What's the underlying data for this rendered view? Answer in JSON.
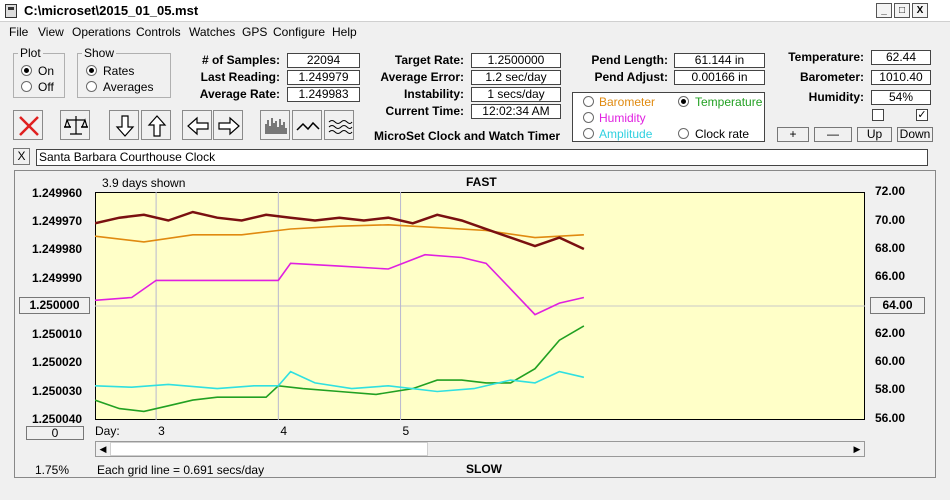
{
  "window": {
    "title": "C:\\microset\\2015_01_05.mst",
    "min": "_",
    "max": "□",
    "close": "X"
  },
  "menu": [
    "File",
    "View",
    "Operations",
    "Controls",
    "Watches",
    "GPS",
    "Configure",
    "Help"
  ],
  "plot": {
    "legend": "Plot",
    "on": "On",
    "off": "Off",
    "selected": "On"
  },
  "show": {
    "legend": "Show",
    "rates": "Rates",
    "averages": "Averages",
    "selected": "Rates"
  },
  "stats": {
    "samples_label": "# of Samples:",
    "samples": "22094",
    "last_label": "Last Reading:",
    "last": "1.249979",
    "avg_rate_label": "Average Rate:",
    "avg_rate": "1.249983"
  },
  "target": {
    "rate_label": "Target Rate:",
    "rate": "1.2500000",
    "avg_err_label": "Average Error:",
    "avg_err": "1.2 sec/day",
    "instab_label": "Instability:",
    "instab": "1 secs/day",
    "time_label": "Current Time:",
    "time": "12:02:34 AM"
  },
  "app_name": "MicroSet Clock and Watch Timer",
  "pend": {
    "len_label": "Pend Length:",
    "len": "61.144 in",
    "adj_label": "Pend Adjust:",
    "adj": "0.00166 in"
  },
  "overlay": {
    "barometer": "Barometer",
    "temperature": "Temperature",
    "humidity": "Humidity",
    "amplitude": "Amplitude",
    "clock_rate": "Clock rate",
    "selected": "Temperature"
  },
  "env": {
    "temp_label": "Temperature:",
    "temp": "62.44",
    "baro_label": "Barometer:",
    "baro": "1010.40",
    "hum_label": "Humidity:",
    "hum": "54%",
    "check1": false,
    "check2": true
  },
  "scale_buttons": {
    "plus": "+",
    "minus": "—",
    "up": "Up",
    "down": "Down"
  },
  "clock_name": "Santa Barbara Courthouse Clock",
  "clear_btn": "X",
  "chart_header": {
    "days_shown": "3.9 days shown",
    "fast": "FAST",
    "slow": "SLOW"
  },
  "footer": {
    "left_value": "0",
    "pct": "1.75%",
    "grid_note": "Each grid line = 0.691 secs/day",
    "day_label": "Day:"
  },
  "colors": {
    "plot_bg": "#ffffc8",
    "rate": "#7a1010",
    "temperature": "#22a022",
    "humidity": "#e020e0",
    "amplitude": "#30e0e0",
    "barometer": "#e08a10"
  },
  "chart_data": {
    "type": "line",
    "y_left": {
      "ticks": [
        "1.249960",
        "1.249970",
        "1.249980",
        "1.249990",
        "1.250000",
        "1.250010",
        "1.250020",
        "1.250030",
        "1.250040"
      ],
      "center_button": "1.250000",
      "inverted": true
    },
    "y_right": {
      "ticks": [
        "72.00",
        "70.00",
        "68.00",
        "66.00",
        "64.00",
        "62.00",
        "60.00",
        "58.00",
        "56.00"
      ],
      "center_button": "64.00"
    },
    "x_days": [
      "3",
      "4",
      "5"
    ],
    "x_range_days": [
      2,
      8.3
    ],
    "series": [
      {
        "name": "Rates",
        "axis": "left",
        "x": [
          2.0,
          2.2,
          2.4,
          2.6,
          2.8,
          3.0,
          3.2,
          3.4,
          3.6,
          3.8,
          4.0,
          4.2,
          4.4,
          4.6,
          4.8,
          5.0,
          5.2,
          5.4,
          5.6,
          5.8,
          6.0
        ],
        "y": [
          1.249971,
          1.249969,
          1.249968,
          1.24997,
          1.249967,
          1.249969,
          1.24997,
          1.249968,
          1.249969,
          1.24997,
          1.249969,
          1.24997,
          1.249969,
          1.249971,
          1.249968,
          1.24997,
          1.249973,
          1.249976,
          1.249979,
          1.249976,
          1.24998
        ]
      },
      {
        "name": "Barometer",
        "axis": "right",
        "x": [
          2.0,
          2.4,
          2.8,
          3.2,
          3.6,
          4.0,
          4.4,
          4.8,
          5.2,
          5.6,
          6.0
        ],
        "y": [
          68.9,
          68.5,
          69.0,
          69.0,
          69.4,
          69.6,
          69.7,
          69.5,
          69.3,
          68.8,
          69.0
        ]
      },
      {
        "name": "Temperature",
        "axis": "right",
        "x": [
          2.0,
          2.2,
          2.4,
          2.6,
          2.8,
          3.0,
          3.2,
          3.4,
          3.5,
          3.7,
          4.0,
          4.3,
          4.6,
          4.8,
          5.0,
          5.2,
          5.4,
          5.6,
          5.8,
          6.0
        ],
        "y": [
          57.4,
          56.8,
          56.6,
          57.0,
          57.4,
          57.6,
          57.6,
          57.6,
          58.4,
          58.2,
          58.0,
          57.8,
          58.2,
          58.8,
          58.8,
          58.6,
          58.6,
          59.6,
          61.6,
          62.6
        ]
      },
      {
        "name": "Humidity",
        "axis": "right",
        "x": [
          2.0,
          2.3,
          2.5,
          3.0,
          3.3,
          3.5,
          3.6,
          4.0,
          4.4,
          4.7,
          5.0,
          5.2,
          5.4,
          5.6,
          5.8,
          6.0
        ],
        "y": [
          64.4,
          64.6,
          65.8,
          65.8,
          65.8,
          65.8,
          67.0,
          66.8,
          66.6,
          67.6,
          67.4,
          67.0,
          65.2,
          63.4,
          64.2,
          64.6
        ]
      },
      {
        "name": "Amplitude",
        "axis": "right",
        "x": [
          2.0,
          2.3,
          2.6,
          3.0,
          3.3,
          3.5,
          3.6,
          3.8,
          4.1,
          4.4,
          4.8,
          5.1,
          5.4,
          5.6,
          5.8,
          6.0
        ],
        "y": [
          58.4,
          58.3,
          58.5,
          58.2,
          58.4,
          58.4,
          59.4,
          58.6,
          58.2,
          58.4,
          58.0,
          58.2,
          58.8,
          58.6,
          59.4,
          59.0
        ]
      }
    ]
  }
}
